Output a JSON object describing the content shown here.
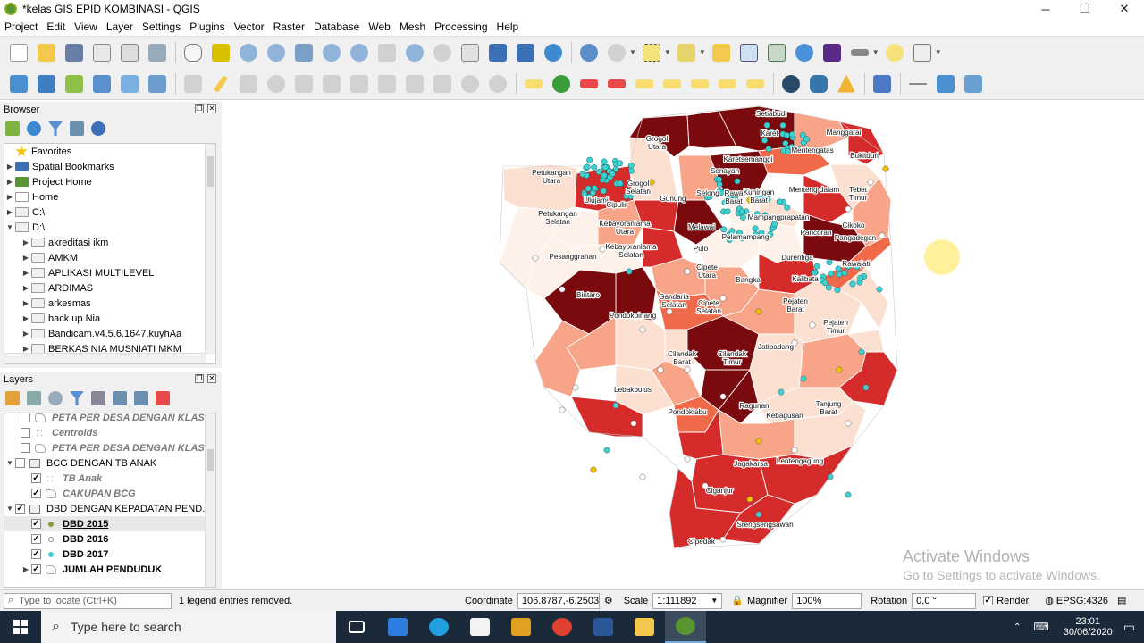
{
  "window": {
    "title": "*kelas GIS EPID KOMBINASI - QGIS",
    "minimize": "─",
    "maximize": "❐",
    "close": "✕"
  },
  "menu": [
    "Project",
    "Edit",
    "View",
    "Layer",
    "Settings",
    "Plugins",
    "Vector",
    "Raster",
    "Database",
    "Web",
    "Mesh",
    "Processing",
    "Help"
  ],
  "colors": {
    "dark": "#7b0a0e",
    "red": "#d62b2b",
    "orange": "#f06a4a",
    "salmon": "#f7a489",
    "light": "#fbe0d2",
    "pale": "#fdf1ea",
    "cyan": "#3fd0d0",
    "yellow": "#f2c200"
  },
  "browser": {
    "title": "Browser",
    "items": [
      {
        "label": "Favorites",
        "icon": "star-icon",
        "level": 0,
        "arrow": ""
      },
      {
        "label": "Spatial Bookmarks",
        "icon": "bookmark-icon",
        "level": 0,
        "arrow": "▶"
      },
      {
        "label": "Project Home",
        "icon": "project-home-icon",
        "level": 0,
        "arrow": "▶"
      },
      {
        "label": "Home",
        "icon": "home-icon",
        "level": 0,
        "arrow": "▶"
      },
      {
        "label": "C:\\",
        "icon": "drive-icon",
        "level": 0,
        "arrow": "▶"
      },
      {
        "label": "D:\\",
        "icon": "drive-icon",
        "level": 0,
        "arrow": "▼"
      },
      {
        "label": "akreditasi ikm",
        "icon": "folder-icon",
        "level": 1,
        "arrow": "▶"
      },
      {
        "label": "AMKM",
        "icon": "folder-icon",
        "level": 1,
        "arrow": "▶"
      },
      {
        "label": "APLIKASI MULTILEVEL",
        "icon": "folder-icon",
        "level": 1,
        "arrow": "▶"
      },
      {
        "label": "ARDIMAS",
        "icon": "folder-icon",
        "level": 1,
        "arrow": "▶"
      },
      {
        "label": "arkesmas",
        "icon": "folder-icon",
        "level": 1,
        "arrow": "▶"
      },
      {
        "label": "back up Nia",
        "icon": "folder-icon",
        "level": 1,
        "arrow": "▶"
      },
      {
        "label": "Bandicam.v4.5.6.1647.kuyhAa",
        "icon": "folder-icon",
        "level": 1,
        "arrow": "▶"
      },
      {
        "label": "BERKAS NIA MUSNIATI MKM",
        "icon": "folder-icon",
        "level": 1,
        "arrow": "▶"
      }
    ]
  },
  "layers": {
    "title": "Layers",
    "items": [
      {
        "label": "PETA PER DESA DENGAN KLAS...",
        "checked": false,
        "style": "italic-grey",
        "level": 1,
        "arrow": ""
      },
      {
        "label": "Centroids",
        "checked": false,
        "style": "italic-grey",
        "level": 1,
        "arrow": ""
      },
      {
        "label": "PETA PER DESA DENGAN KLAS...",
        "checked": false,
        "style": "italic-grey",
        "level": 1,
        "arrow": ""
      },
      {
        "label": "BCG DENGAN TB ANAK",
        "checked": false,
        "style": "group",
        "level": 0,
        "arrow": "▼"
      },
      {
        "label": "TB Anak",
        "checked": true,
        "style": "italic-grey",
        "level": 2,
        "arrow": ""
      },
      {
        "label": "CAKUPAN BCG",
        "checked": true,
        "style": "italic-grey",
        "level": 2,
        "arrow": ""
      },
      {
        "label": "DBD DENGAN KEPADATAN PEND...",
        "checked": true,
        "style": "group",
        "level": 0,
        "arrow": "▼"
      },
      {
        "label": "DBD 2015",
        "checked": true,
        "style": "bold-underline",
        "level": 2,
        "arrow": ""
      },
      {
        "label": "DBD 2016",
        "checked": true,
        "style": "bold",
        "level": 2,
        "arrow": ""
      },
      {
        "label": "DBD 2017",
        "checked": true,
        "style": "bold",
        "level": 2,
        "arrow": ""
      },
      {
        "label": "JUMLAH PENDUDUK",
        "checked": true,
        "style": "bold",
        "level": 2,
        "arrow": "▶"
      }
    ]
  },
  "map": {
    "labels": [
      "Setiabudi",
      "Manggarai",
      "Grogol Utara",
      "Karet",
      "Mentengatas",
      "Bukitduri",
      "Karetsemanggi",
      "Petukangan Utara",
      "Grogol Selatan",
      "Senayan",
      "Menteng dalam",
      "Tebet Timur",
      "Ulujami",
      "Cipulir",
      "Gunung",
      "Selong",
      "Rawa Barat",
      "Kuningan Barat",
      "Mampangprapatan",
      "Cikoko",
      "Petukangan Selatan",
      "Kebayoranlama Utara",
      "Melawai",
      "Pelamampang",
      "Pancoran",
      "Pangadegan",
      "Kebayoranlama Selatan",
      "Pulo",
      "Durentiga",
      "Pesanggrahan",
      "Rawajati",
      "Cipete Utara",
      "Bangka",
      "Kalibata",
      "Bintaro",
      "Gandaria Selatan",
      "Cipete Selatan",
      "Pejaten Barat",
      "Pondokpinang",
      "Pejaten Timur",
      "Jatipadang",
      "Cilandak Barat",
      "Cilandak Timur",
      "Lebakbulus",
      "Ragunan",
      "Kebagusan",
      "Tanjung Barat",
      "Pondoklabu",
      "Jagakarsa",
      "Lentengagung",
      "Ciganjur",
      "Srengsengsawah",
      "Cipedak"
    ],
    "watermark_title": "Activate Windows",
    "watermark_sub": "Go to Settings to activate Windows."
  },
  "status": {
    "locate_placeholder": "Type to locate (Ctrl+K)",
    "message": "1 legend entries removed.",
    "coordinate_label": "Coordinate",
    "coordinate": "106.8787,-6.2503",
    "scale_label": "Scale",
    "scale": "1:111892",
    "magnifier_label": "Magnifier",
    "magnifier": "100%",
    "rotation_label": "Rotation",
    "rotation": "0,0 °",
    "render_label": "Render",
    "crs": "EPSG:4326"
  },
  "taskbar": {
    "search_placeholder": "Type here to search",
    "time": "23:01",
    "date": "30/06/2020"
  }
}
